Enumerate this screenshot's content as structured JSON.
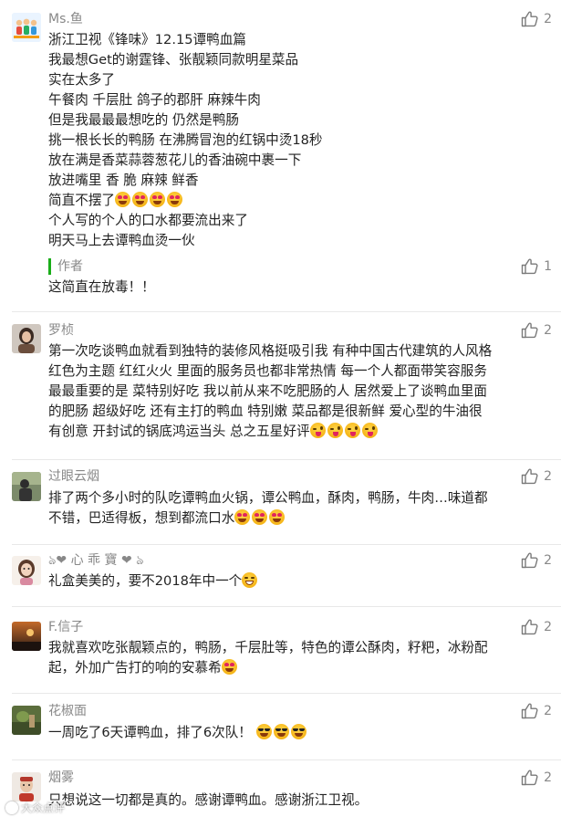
{
  "comments": [
    {
      "nick": "Ms.鱼",
      "likes": "2",
      "lines": [
        "浙江卫视《锋味》12.15谭鸭血篇",
        "我最想Get的谢霆锋、张靓颖同款明星菜品",
        "实在太多了",
        "午餐肉 千层肚 鸽子的郡肝 麻辣牛肉",
        "但是我最最最想吃的 仍然是鸭肠",
        "挑一根长长的鸭肠 在沸腾冒泡的红锅中烫18秒",
        "放在满是香菜蒜蓉葱花儿的香油碗中裹一下",
        "放进嘴里 香 脆 麻辣 鲜香",
        "简直不摆了",
        "个人写的个人的口水都要流出来了",
        "明天马上去谭鸭血烫一伙"
      ],
      "reply": {
        "author_label": "作者",
        "likes": "1",
        "text": "这简直在放毒！！"
      }
    },
    {
      "nick": "罗桢",
      "likes": "2",
      "lines": [
        "第一次吃谈鸭血就看到独特的装修风格挺吸引我 有种中国古代建筑的人风格",
        "红色为主题 红红火火 里面的服务员也都非常热情 每一个人都面带笑容服务",
        "最最重要的是 菜特别好吃  我以前从来不吃肥肠的人 居然爱上了谈鸭血里面",
        "的肥肠 超级好吃  还有主打的鸭血 特别嫩 菜品都是很新鲜 爱心型的牛油很",
        "有创意 开封试的锅底鸿运当头 总之五星好评"
      ]
    },
    {
      "nick": "过眼云烟",
      "likes": "2",
      "lines": [
        "排了两个多小时的队吃谭鸭血火锅，谭公鸭血，酥肉，鸭肠，牛肉…味道都",
        "不错，巴适得板，想到都流口水"
      ]
    },
    {
      "nick": "ঌ❤ 心 乖 寶 ❤ ঌ",
      "likes": "2",
      "lines": [
        "礼盒美美的，要不2018年中一个"
      ]
    },
    {
      "nick": "F.信子",
      "likes": "2",
      "lines": [
        "我就喜欢吃张靓颖点的，鸭肠，千层肚等，特色的谭公酥肉，籽粑，冰粉配",
        "起，外加广告打的响的安慕希"
      ]
    },
    {
      "nick": "花椒面",
      "likes": "2",
      "lines": [
        "一周吃了6天谭鸭血，排了6次队！"
      ]
    },
    {
      "nick": "烟雾",
      "likes": "2",
      "lines": [
        "只想说这一切都是真的。感谢谭鸭血。感谢浙江卫视。"
      ]
    }
  ],
  "watermark": "大众点评",
  "icons": {
    "like": "thumbs-up-icon",
    "emoji_heart_eyes": "heart-eyes-emoji",
    "emoji_wink_tongue": "wink-tongue-emoji",
    "emoji_grin": "grin-emoji",
    "emoji_sunglasses": "sunglasses-emoji"
  },
  "colors": {
    "nick": "#888888",
    "text": "#222222",
    "author_bar": "#1aad19",
    "divider": "#e8e8e8"
  }
}
